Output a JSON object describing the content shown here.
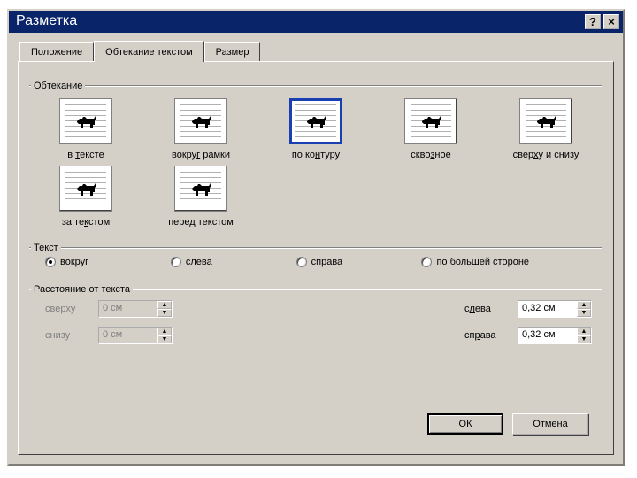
{
  "title": "Разметка",
  "titlebar": {
    "help": "?",
    "close": "×"
  },
  "tabs": {
    "position": "Положение",
    "wrap": "Обтекание текстом",
    "size": "Размер"
  },
  "groups": {
    "wrapping": "Обтекание",
    "text": "Текст",
    "distance": "Расстояние от текста"
  },
  "wrap_options": [
    {
      "key": "inline",
      "caption_pre": "в ",
      "caption_u": "т",
      "caption_post": "ексте"
    },
    {
      "key": "square",
      "caption_pre": "вокру",
      "caption_u": "г",
      "caption_post": " рамки"
    },
    {
      "key": "tight",
      "caption_pre": "по ко",
      "caption_u": "н",
      "caption_post": "туру",
      "selected": true
    },
    {
      "key": "through",
      "caption_pre": "скво",
      "caption_u": "з",
      "caption_post": "ное"
    },
    {
      "key": "topbot",
      "caption_pre": "свер",
      "caption_u": "х",
      "caption_post": "у и снизу"
    },
    {
      "key": "behind",
      "caption_pre": "за те",
      "caption_u": "к",
      "caption_post": "стом"
    },
    {
      "key": "front",
      "caption_pre": "пере",
      "caption_u": "д",
      "caption_post": " текстом"
    }
  ],
  "text_wrap": [
    {
      "key": "around",
      "pre": "в",
      "u": "о",
      "post": "круг",
      "checked": true
    },
    {
      "key": "left",
      "pre": "с",
      "u": "л",
      "post": "ева"
    },
    {
      "key": "right",
      "pre": "с",
      "u": "п",
      "post": "рава"
    },
    {
      "key": "largest",
      "pre": "по боль",
      "u": "ш",
      "post": "ей стороне"
    }
  ],
  "distance": {
    "top": {
      "label": "сверху",
      "value": "0 см",
      "enabled": false
    },
    "bottom": {
      "label": "снизу",
      "value": "0 см",
      "enabled": false
    },
    "left": {
      "pre": "с",
      "u": "л",
      "post": "ева",
      "value": "0,32 см",
      "enabled": true
    },
    "right": {
      "pre": "сп",
      "u": "р",
      "post": "ава",
      "value": "0,32 см",
      "enabled": true
    }
  },
  "buttons": {
    "ok": "ОК",
    "cancel": "Отмена"
  }
}
